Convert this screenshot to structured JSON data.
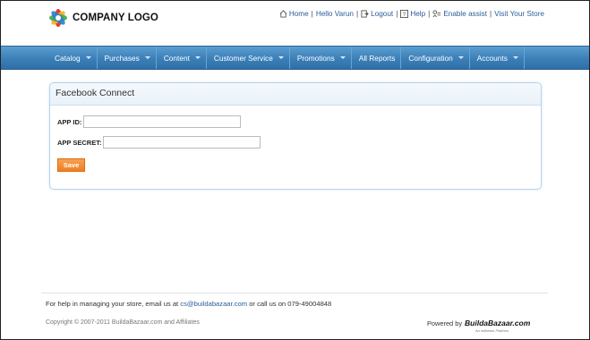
{
  "header": {
    "logo_text": "COMPANY LOGO",
    "links": [
      {
        "label": "Home",
        "icon": "home-icon"
      },
      {
        "label": "Hello Varun"
      },
      {
        "label": "Logout",
        "icon": "logout-icon"
      },
      {
        "label": "Help",
        "icon": "help-icon"
      },
      {
        "label": "Enable assist",
        "icon": "assist-icon"
      },
      {
        "label": "Visit Your Store"
      }
    ]
  },
  "nav": {
    "items": [
      {
        "label": "Catalog"
      },
      {
        "label": "Purchases"
      },
      {
        "label": "Content"
      },
      {
        "label": "Customer Service"
      },
      {
        "label": "Promotions"
      },
      {
        "label": "All Reports"
      },
      {
        "label": "Configuration"
      },
      {
        "label": "Accounts"
      }
    ]
  },
  "panel": {
    "title": "Facebook Connect",
    "app_id_label": "APP ID:",
    "app_id_value": "",
    "app_secret_label": "APP SECRET:",
    "app_secret_value": "",
    "save_label": "Save"
  },
  "footer": {
    "help_prefix": "For help in managing your store, email us at ",
    "help_email": "cs@buildabazaar.com",
    "help_suffix": " or call us on 079-49004848",
    "copyright": "Copyright © 2007-2011 BuildaBazaar.com and Affiliates",
    "powered_by": "Powered by",
    "brand": "BuildaBazaar.com",
    "brand_sub": "An Infibeam Platform"
  },
  "colors": {
    "nav": "#3b7fb8",
    "accent_link": "#2a5d9a",
    "save_button": "#ef7f22",
    "panel_border": "#b9d3ea"
  }
}
